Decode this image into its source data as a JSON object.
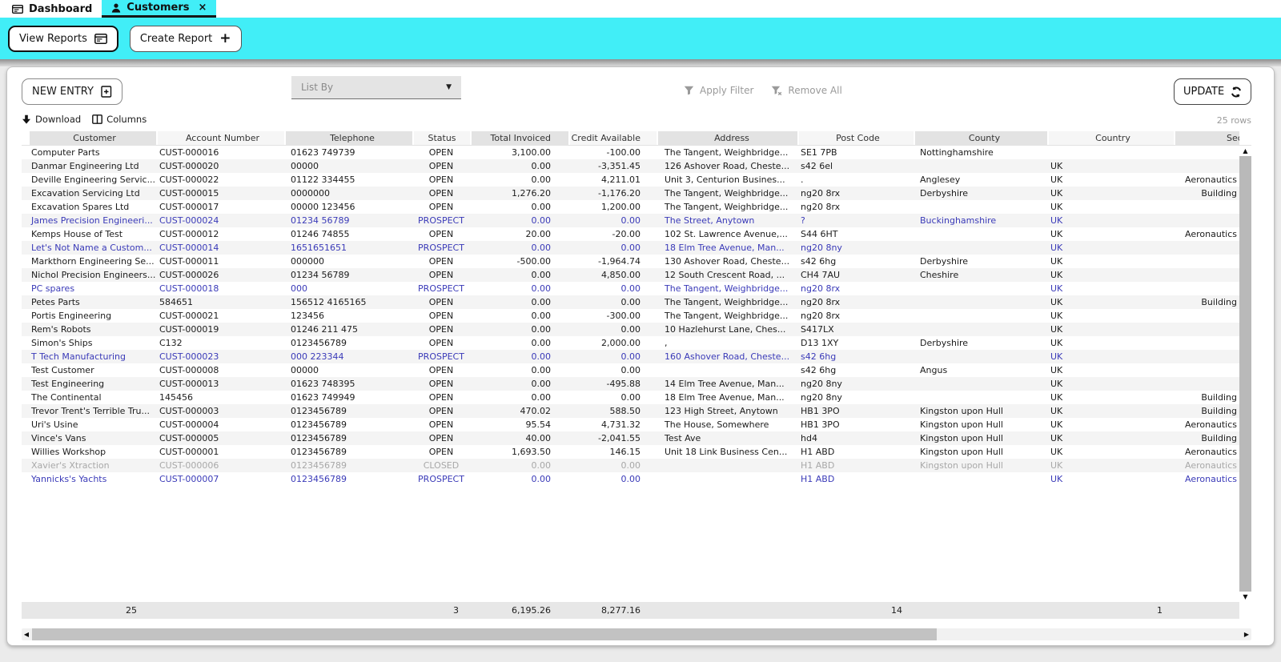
{
  "tabs": {
    "dashboard": "Dashboard",
    "customers": "Customers"
  },
  "toolbar": {
    "view_reports": "View Reports",
    "create_report": "Create Report"
  },
  "panel": {
    "new_entry": "NEW ENTRY",
    "list_by": "List By",
    "apply_filter": "Apply Filter",
    "remove_all": "Remove All",
    "update": "UPDATE",
    "download": "Download",
    "columns": "Columns",
    "row_count": "25 rows"
  },
  "glyphs": {
    "close": "×",
    "caret_down": "▼",
    "plus": "+",
    "scroll_up": "▲",
    "scroll_down": "▼",
    "scroll_left": "◀",
    "scroll_right": "▶"
  },
  "colors": {
    "accent_cyan": "#41EEF7",
    "prospect_blue": "#3A3AB8",
    "closed_gray": "#A8A8A8",
    "header_alt": "#E3E3E3",
    "row_alt": "#F4F4F4"
  },
  "table": {
    "headers": [
      "Customer",
      "Account Number",
      "Telephone",
      "Status",
      "Total Invoiced",
      "Credit Available",
      "Address",
      "Post Code",
      "County",
      "Country",
      "Sector"
    ],
    "rows": [
      {
        "style": "normal",
        "cells": [
          "Computer Parts",
          "CUST-000016",
          "01623 749739",
          "OPEN",
          "3,100.00",
          "-100.00",
          "The Tangent, Weighbridge...",
          "SE1 7PB",
          "Nottinghamshire",
          "",
          ""
        ]
      },
      {
        "style": "normal",
        "cells": [
          "Danmar Engineering Ltd",
          "CUST-000020",
          "00000",
          "OPEN",
          "0.00",
          "-3,351.45",
          "126 Ashover Road, Cheste...",
          "s42 6el",
          "",
          "UK",
          ""
        ]
      },
      {
        "style": "normal",
        "cells": [
          "Deville Engineering Servic...",
          "CUST-000022",
          "01122 334455",
          "OPEN",
          "0.00",
          "4,211.01",
          "Unit 3, Centurion Busines...",
          ".",
          "Anglesey",
          "UK",
          "Aeronautics"
        ]
      },
      {
        "style": "normal",
        "cells": [
          "Excavation Servicing Ltd",
          "CUST-000015",
          "0000000",
          "OPEN",
          "1,276.20",
          "-1,176.20",
          "The Tangent, Weighbridge...",
          "ng20 8rx",
          "Derbyshire",
          "UK",
          "Building"
        ]
      },
      {
        "style": "normal",
        "cells": [
          "Excavation Spares Ltd",
          "CUST-000017",
          "00000 123456",
          "OPEN",
          "0.00",
          "1,200.00",
          "The Tangent, Weighbridge...",
          "ng20 8rx",
          "",
          "UK",
          ""
        ]
      },
      {
        "style": "prospect",
        "cells": [
          "James Precision Engineeri...",
          "CUST-000024",
          "01234 56789",
          "PROSPECT",
          "0.00",
          "0.00",
          "The Street, Anytown",
          "?",
          "Buckinghamshire",
          "UK",
          ""
        ]
      },
      {
        "style": "normal",
        "cells": [
          "Kemps House of Test",
          "CUST-000012",
          "01246 74855",
          "OPEN",
          "20.00",
          "-20.00",
          "102 St. Lawrence Avenue,...",
          "S44 6HT",
          "",
          "UK",
          "Aeronautics"
        ]
      },
      {
        "style": "prospect",
        "cells": [
          "Let's Not Name a Custom...",
          "CUST-000014",
          "1651651651",
          "PROSPECT",
          "0.00",
          "0.00",
          "18 Elm Tree Avenue, Man...",
          "ng20 8ny",
          "",
          "UK",
          ""
        ]
      },
      {
        "style": "normal",
        "cells": [
          "Markthorn Engineering Se...",
          "CUST-000011",
          "000000",
          "OPEN",
          "-500.00",
          "-1,964.74",
          "130 Ashover Road, Cheste...",
          "s42 6hg",
          "Derbyshire",
          "UK",
          ""
        ]
      },
      {
        "style": "normal",
        "cells": [
          "Nichol Precision Engineers...",
          "CUST-000026",
          "01234 56789",
          "OPEN",
          "0.00",
          "4,850.00",
          "12 South Crescent Road, ...",
          "CH4 7AU",
          "Cheshire",
          "UK",
          ""
        ]
      },
      {
        "style": "prospect",
        "cells": [
          "PC spares",
          "CUST-000018",
          "000",
          "PROSPECT",
          "0.00",
          "0.00",
          "The Tangent, Weighbridge...",
          "ng20 8rx",
          "",
          "UK",
          ""
        ]
      },
      {
        "style": "normal",
        "cells": [
          "Petes Parts",
          "584651",
          "156512 4165165",
          "OPEN",
          "0.00",
          "0.00",
          "The Tangent, Weighbridge...",
          "ng20 8rx",
          "",
          "UK",
          "Building"
        ]
      },
      {
        "style": "normal",
        "cells": [
          "Portis Engineering",
          "CUST-000021",
          "123456",
          "OPEN",
          "0.00",
          "-300.00",
          "The Tangent, Weighbridge...",
          "ng20 8rx",
          "",
          "UK",
          ""
        ]
      },
      {
        "style": "normal",
        "cells": [
          "Rem's Robots",
          "CUST-000019",
          "01246 211 475",
          "OPEN",
          "0.00",
          "0.00",
          "10 Hazlehurst Lane, Ches...",
          "S417LX",
          "",
          "UK",
          ""
        ]
      },
      {
        "style": "normal",
        "cells": [
          "Simon's Ships",
          "C132",
          "0123456789",
          "OPEN",
          "0.00",
          "2,000.00",
          ",",
          "D13 1XY",
          "Derbyshire",
          "UK",
          ""
        ]
      },
      {
        "style": "prospect",
        "cells": [
          "T Tech Manufacturing",
          "CUST-000023",
          "000 223344",
          "PROSPECT",
          "0.00",
          "0.00",
          "160 Ashover Road, Cheste...",
          "s42 6hg",
          "",
          "UK",
          ""
        ]
      },
      {
        "style": "normal",
        "cells": [
          "Test Customer",
          "CUST-000008",
          "00000",
          "OPEN",
          "0.00",
          "0.00",
          "",
          "s42 6hg",
          "Angus",
          "UK",
          ""
        ]
      },
      {
        "style": "normal",
        "cells": [
          "Test Engineering",
          "CUST-000013",
          "01623 748395",
          "OPEN",
          "0.00",
          "-495.88",
          "14 Elm Tree Avenue, Man...",
          "ng20 8ny",
          "",
          "UK",
          ""
        ]
      },
      {
        "style": "normal",
        "cells": [
          "The Continental",
          "145456",
          "01623 749949",
          "OPEN",
          "0.00",
          "0.00",
          "18 Elm Tree Avenue, Man...",
          "ng20 8ny",
          "",
          "UK",
          "Building"
        ]
      },
      {
        "style": "normal",
        "cells": [
          "Trevor Trent's Terrible Tru...",
          "CUST-000003",
          "0123456789",
          "OPEN",
          "470.02",
          "588.50",
          "123 High Street, Anytown",
          "HB1 3PO",
          "Kingston upon Hull",
          "UK",
          "Building"
        ]
      },
      {
        "style": "normal",
        "cells": [
          "Uri's Usine",
          "CUST-000004",
          "0123456789",
          "OPEN",
          "95.54",
          "4,731.32",
          "The House, Somewhere",
          "HB1 3PO",
          "Kingston upon Hull",
          "UK",
          "Aeronautics"
        ]
      },
      {
        "style": "normal",
        "cells": [
          "Vince's Vans",
          "CUST-000005",
          "0123456789",
          "OPEN",
          "40.00",
          "-2,041.55",
          "Test Ave",
          "hd4",
          "Kingston upon Hull",
          "UK",
          "Building"
        ]
      },
      {
        "style": "normal",
        "cells": [
          "Willies Workshop",
          "CUST-000001",
          "0123456789",
          "OPEN",
          "1,693.50",
          "146.15",
          "Unit 18 Link Business Cen...",
          "H1 ABD",
          "Kingston upon Hull",
          "UK",
          "Aeronautics"
        ]
      },
      {
        "style": "closed",
        "cells": [
          "Xavier's Xtraction",
          "CUST-000006",
          "0123456789",
          "CLOSED",
          "0.00",
          "0.00",
          "",
          "H1 ABD",
          "Kingston upon Hull",
          "UK",
          "Aeronautics"
        ]
      },
      {
        "style": "prospect",
        "cells": [
          "Yannicks's Yachts",
          "CUST-000007",
          "0123456789",
          "PROSPECT",
          "0.00",
          "0.00",
          "",
          "H1 ABD",
          "",
          "UK",
          "Aeronautics"
        ]
      }
    ],
    "summary": [
      "",
      "25",
      "",
      "",
      "3",
      "6,195.26",
      "8,277.16",
      "",
      "14",
      "",
      "1",
      ""
    ]
  }
}
